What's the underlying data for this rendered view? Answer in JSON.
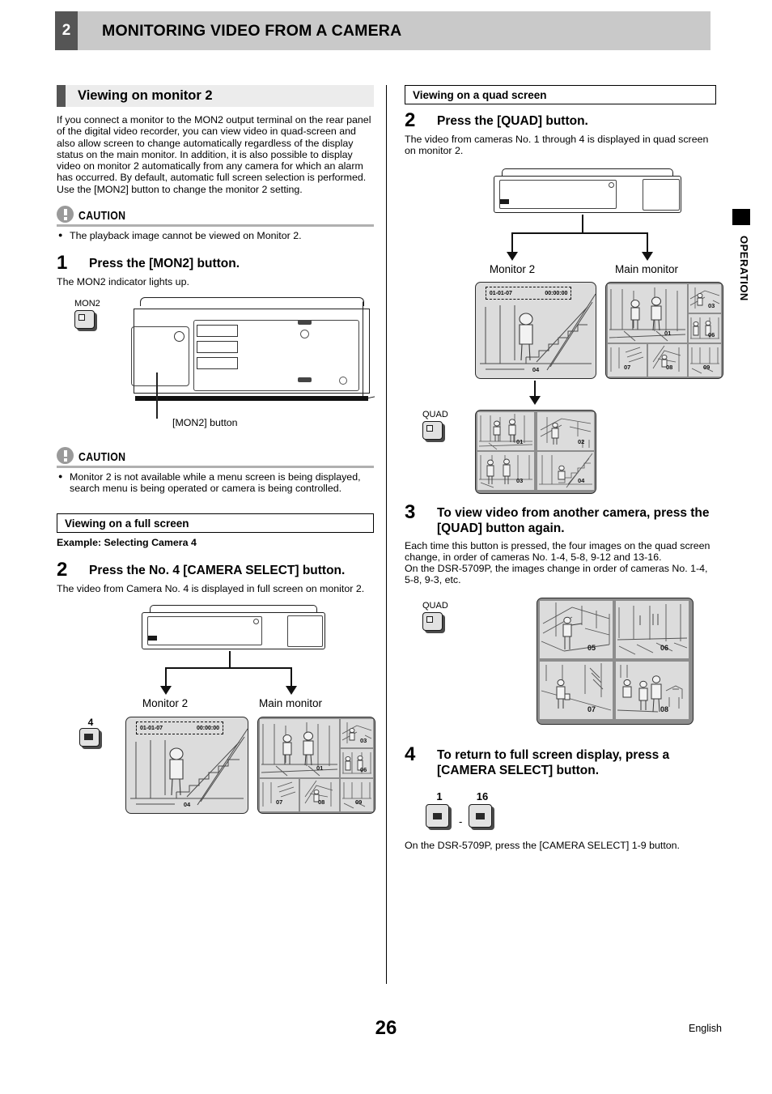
{
  "header": {
    "chapter_number": "2",
    "title": "MONITORING VIDEO FROM A CAMERA"
  },
  "side_tab": {
    "label": "OPERATION"
  },
  "footer": {
    "page_number": "26",
    "language": "English"
  },
  "left_column": {
    "section_heading": "Viewing on monitor 2",
    "intro_paragraph": "If you connect a monitor to the MON2 output terminal on the rear panel of the digital video recorder, you can view video in quad-screen and also allow screen to change automatically regardless of the display status on the main monitor. In addition, it is also possible to display video on monitor 2 automatically from any camera for which an alarm has occurred. By default, automatic full screen selection is performed.",
    "intro_paragraph2": "Use the [MON2] button to change the monitor 2 setting.",
    "caution1": {
      "label": "CAUTION",
      "items": [
        "The playback image cannot be viewed on Monitor 2."
      ]
    },
    "step1": {
      "number": "1",
      "title": "Press the [MON2] button.",
      "body": "The MON2 indicator lights up."
    },
    "figure1": {
      "button_label": "MON2",
      "callout": "[MON2] button"
    },
    "caution2": {
      "label": "CAUTION",
      "items": [
        "Monitor 2 is not available while a menu screen is being displayed, search menu is being operated or camera is being controlled."
      ]
    },
    "subsection_heading": "Viewing on a full screen",
    "example_line": "Example: Selecting Camera 4",
    "step2": {
      "number": "2",
      "title": "Press the No. 4 [CAMERA SELECT] button.",
      "body": "The video from Camera No. 4 is displayed in full screen on monitor 2."
    },
    "figure2": {
      "button_label": "4",
      "monitor2_caption": "Monitor 2",
      "main_caption": "Main monitor",
      "osd_date": "01-01-07",
      "osd_time": "00:00:00",
      "monitor2_camera": "04",
      "main_cameras": [
        "01",
        "03",
        "06",
        "07",
        "08",
        "09"
      ]
    }
  },
  "right_column": {
    "subsection_heading": "Viewing on a quad screen",
    "step2": {
      "number": "2",
      "title": "Press the [QUAD] button.",
      "body": "The video from cameras No. 1 through 4 is displayed in quad screen on monitor 2."
    },
    "figure1": {
      "monitor2_caption": "Monitor 2",
      "main_caption": "Main monitor",
      "osd_date": "01-01-07",
      "osd_time": "00:00:00",
      "monitor2_camera": "04",
      "main_cameras": [
        "01",
        "03",
        "06",
        "07",
        "08",
        "09"
      ],
      "quad_button_label": "QUAD",
      "quad_cameras": [
        "01",
        "02",
        "03",
        "04"
      ]
    },
    "step3": {
      "number": "3",
      "title": "To view video from another camera, press the [QUAD] button again.",
      "body": "Each time this button is pressed, the four images on the quad screen change, in order of cameras No. 1-4, 5-8, 9-12 and 13-16.",
      "body2": "On the DSR-5709P, the images change in order of cameras No. 1-4, 5-8, 9-3, etc."
    },
    "figure2": {
      "quad_button_label": "QUAD",
      "quad_cameras": [
        "05",
        "06",
        "07",
        "08"
      ]
    },
    "step4": {
      "number": "4",
      "title": "To return to full screen display, press a [CAMERA SELECT] button.",
      "button_first": "1",
      "button_last": "16",
      "button_separator": "-",
      "body": "On the DSR-5709P, press the [CAMERA SELECT] 1-9 button."
    }
  },
  "colors": {
    "header_band": "#c9c9c9",
    "header_number_block": "#555555",
    "section_band": "#ececec",
    "caution_icon": "#9a9a9a",
    "screen_fill": "#dcdcdc"
  }
}
